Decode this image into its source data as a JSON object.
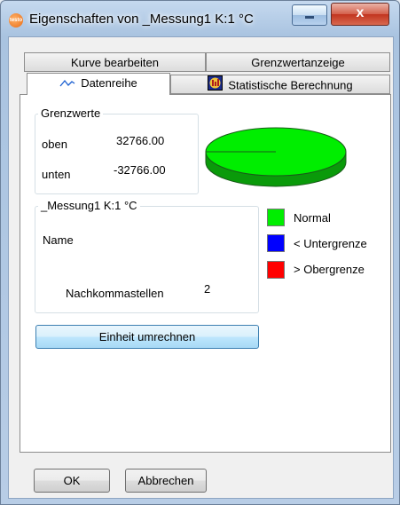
{
  "window": {
    "title": "Eigenschaften von _Messung1 K:1 °C",
    "app_icon_text": "testo",
    "close_glyph": "x"
  },
  "tabs": {
    "kurve": "Kurve bearbeiten",
    "grenzwert": "Grenzwertanzeige",
    "datenreihe": "Datenreihe",
    "statistik": "Statistische Berechnung"
  },
  "limits": {
    "group_title": "Grenzwerte",
    "upper_label": "oben",
    "upper_value": "32766.00",
    "lower_label": "unten",
    "lower_value": "-32766.00"
  },
  "series": {
    "group_title": "_Messung1 K:1 °C",
    "name_label": "Name",
    "decimals_label": "Nachkommastellen",
    "decimals_value": "2"
  },
  "legend": [
    {
      "label": "Normal",
      "color": "#00ee00"
    },
    {
      "label": "< Untergrenze",
      "color": "#0000ff"
    },
    {
      "label": "> Obergrenze",
      "color": "#ff0000"
    }
  ],
  "chart_data": {
    "type": "pie",
    "categories": [
      "Normal",
      "< Untergrenze",
      "> Obergrenze"
    ],
    "values": [
      100,
      0,
      0
    ],
    "colors": [
      "#00ee00",
      "#0000ff",
      "#ff0000"
    ]
  },
  "buttons": {
    "convert": "Einheit umrechnen",
    "ok": "OK",
    "cancel": "Abbrechen"
  }
}
